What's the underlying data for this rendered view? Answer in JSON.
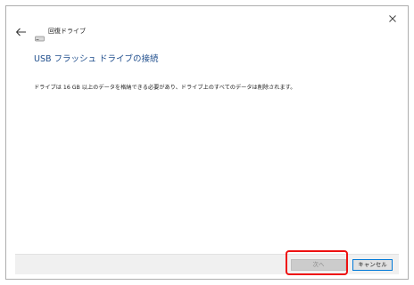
{
  "breadcrumb": {
    "label": "回復ドライブ"
  },
  "main": {
    "title": "USB フラッシュ ドライブの接続",
    "description": "ドライブは 16 GB 以上のデータを格納できる必要があり、ドライブ上のすべてのデータは削除されます。"
  },
  "footer": {
    "next_label": "次へ",
    "cancel_label": "キャンセル"
  },
  "icons": {
    "close": "close-icon",
    "back": "back-arrow-icon",
    "drive": "drive-icon"
  },
  "colors": {
    "title": "#1e4d8c",
    "highlight": "#ee1111",
    "focus_border": "#0078d7"
  }
}
